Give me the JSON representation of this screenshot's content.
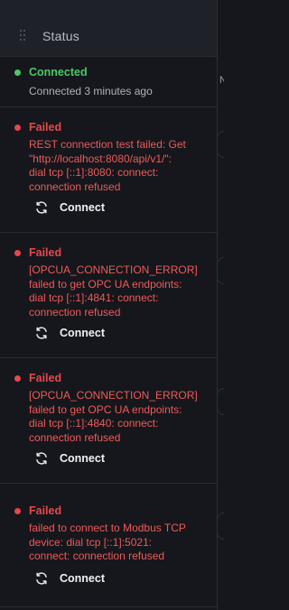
{
  "header": {
    "title": "Status"
  },
  "side": {
    "letter": "N"
  },
  "rows": [
    {
      "status": "Connected",
      "status_color": "#4cc965",
      "lines": [
        "Connected 3 minutes ago"
      ]
    },
    {
      "status": "Failed",
      "status_color": "#e5484d",
      "lines": [
        "REST connection test failed: Get",
        "\"http://localhost:8080/api/v1/\":",
        "dial tcp [::1]:8080: connect:",
        "connection refused"
      ],
      "action": "Connect"
    },
    {
      "status": "Failed",
      "status_color": "#e5484d",
      "lines": [
        "[OPCUA_CONNECTION_ERROR]",
        "failed to get OPC UA endpoints:",
        "dial tcp [::1]:4841: connect:",
        "connection refused"
      ],
      "action": "Connect"
    },
    {
      "status": "Failed",
      "status_color": "#e5484d",
      "lines": [
        "[OPCUA_CONNECTION_ERROR]",
        "failed to get OPC UA endpoints:",
        "dial tcp [::1]:4840: connect:",
        "connection refused"
      ],
      "action": "Connect"
    },
    {
      "status": "Failed",
      "status_color": "#e5484d",
      "lines": [
        "failed to connect to Modbus TCP",
        "device: dial tcp [::1]:5021:",
        "connect: connection refused"
      ],
      "action": "Connect"
    }
  ],
  "icons": {
    "connect": "refresh-icon",
    "status": "status-dot-icon",
    "drag": "drag-handle-icon"
  }
}
